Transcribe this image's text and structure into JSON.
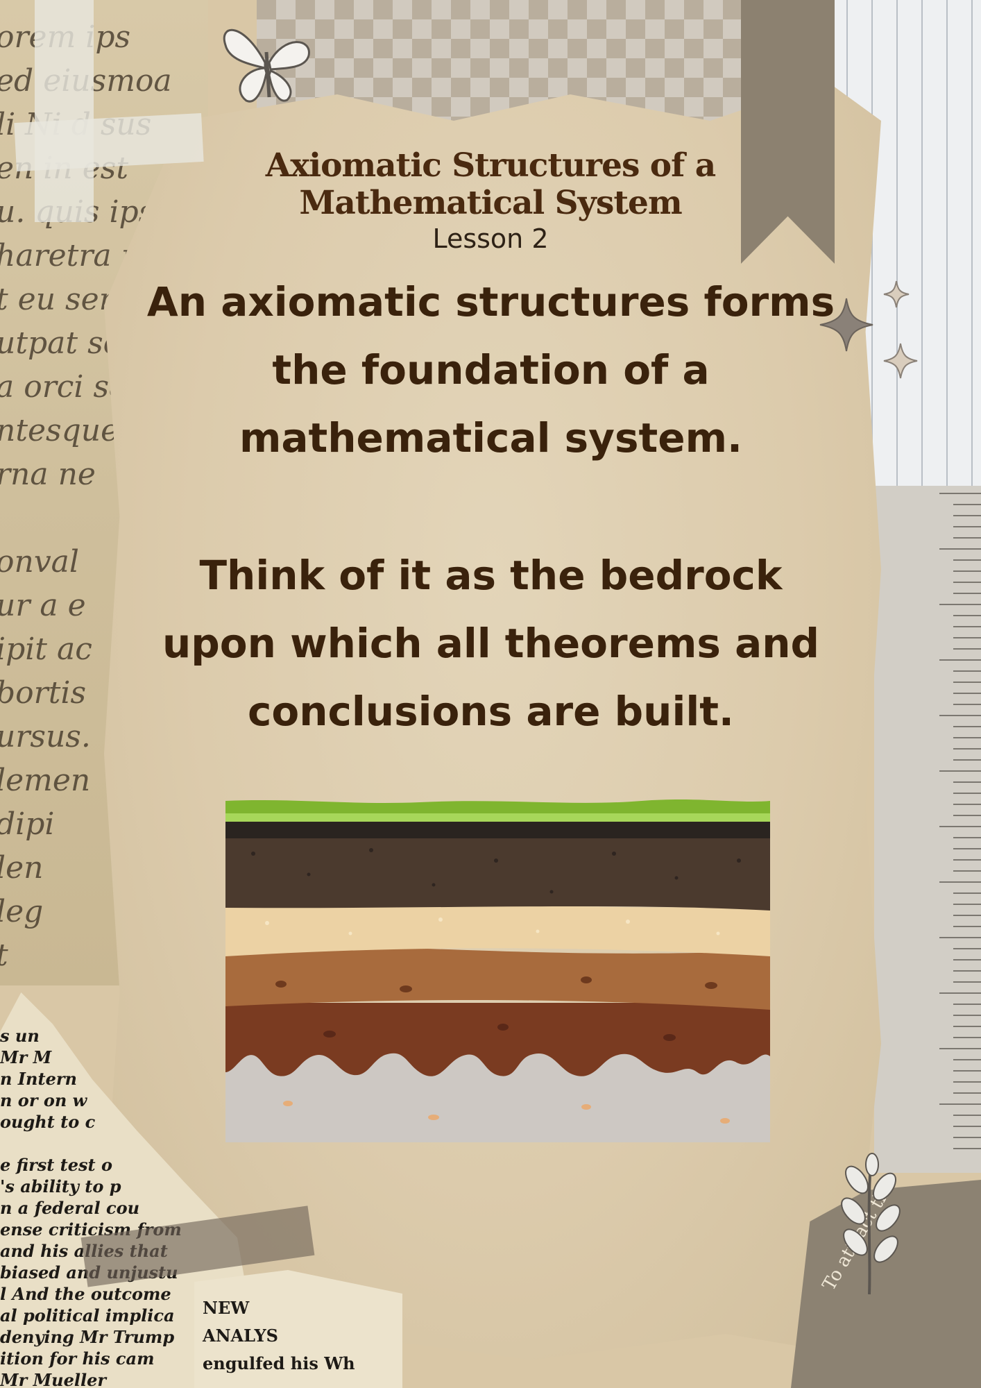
{
  "document": {
    "title_line1": "Axiomatic Structures of a",
    "title_line2": "Mathematical System",
    "subtitle": "Lesson 2",
    "paragraph1": "An axiomatic structures forms the foundation of a mathematical system.",
    "paragraph2": "Think of it as the bedrock upon which all theorems and conclusions are built."
  },
  "decor": {
    "oldpage_lines": [
      "orem ips",
      "ed    eiusmoa",
      "li       Ni  d sus",
      "en        in est",
      "u.  quis  ipsu",
      "haretra mas",
      "t eu sem inte",
      "utpat sed. Ris",
      "a orci sagitti",
      "ntesque el",
      "rna ne",
      "",
      "onval",
      "ur a e",
      "ipit ac",
      "bortis",
      "ursus.",
      "lemen",
      "dipi",
      "len",
      "leg",
      "t"
    ],
    "newspaper_lines": [
      "s  un",
      "Mr M",
      "n Intern",
      "n or on w",
      "ought to c",
      "",
      "e first test o",
      "'s ability to p",
      "n a federal cou",
      "ense criticism from",
      "and his allies that",
      "biased and unjustu",
      "l  And the outcome",
      "al political implica",
      "denying Mr Trump",
      "ition  for his cam",
      "Mr Mueller"
    ],
    "newspaper2_lines": [
      "NEW",
      "ANALYS",
      "engulfed his Wh"
    ],
    "darkpaper_text": "To attract the students"
  },
  "colors": {
    "title": "#4a2a10",
    "body_text": "#3a220c",
    "paper": "#dccbac",
    "grass": "#7fb52f",
    "topsoil": "#4b3a2e",
    "sand": "#ecd2a4",
    "clay": "#a86b3d",
    "subsoil": "#7a3b21",
    "bedrock": "#cdc8c3"
  }
}
